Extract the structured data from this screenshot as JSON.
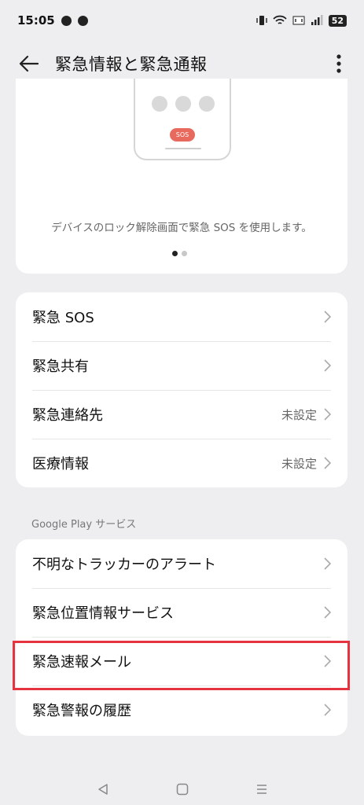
{
  "status_bar": {
    "time": "15:05",
    "battery": "52"
  },
  "app_bar": {
    "title": "緊急情報と緊急通報"
  },
  "intro_card": {
    "sos_label": "SOS",
    "description": "デバイスのロック解除画面で緊急 SOS を使用します。"
  },
  "main_list": [
    {
      "label": "緊急 SOS",
      "value": ""
    },
    {
      "label": "緊急共有",
      "value": ""
    },
    {
      "label": "緊急連絡先",
      "value": "未設定"
    },
    {
      "label": "医療情報",
      "value": "未設定"
    }
  ],
  "google_section": {
    "header": "Google Play サービス",
    "items": [
      {
        "label": "不明なトラッカーのアラート"
      },
      {
        "label": "緊急位置情報サービス"
      },
      {
        "label": "緊急速報メール"
      },
      {
        "label": "緊急警報の履歴"
      }
    ]
  },
  "colors": {
    "highlight": "#e5333f",
    "sos_pill": "#e86a5e"
  },
  "icons": [
    "arrow-left-icon",
    "more-vert-icon",
    "chevron-right-icon",
    "back-triangle-icon",
    "home-square-icon",
    "recents-menu-icon"
  ]
}
